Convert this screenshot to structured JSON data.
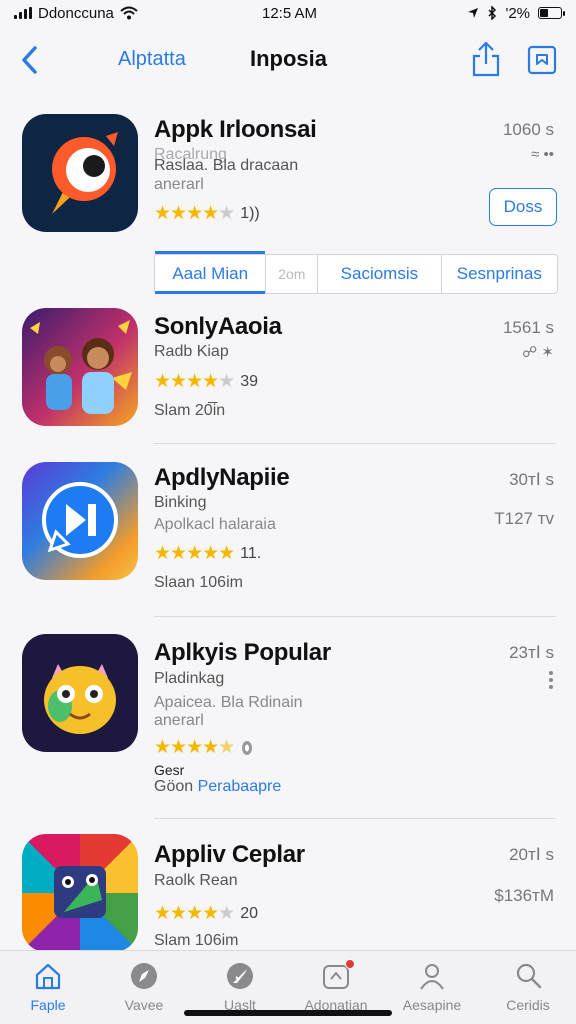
{
  "status_bar": {
    "carrier": "Ddonccuna",
    "time": "12:5 AM",
    "battery_text": "'2%"
  },
  "nav": {
    "back_label": "Alptatta",
    "title": "Inposia"
  },
  "featured": {
    "name": "Appk Irloonsai",
    "subtitle1": "Racalrung",
    "subtitle2": "Raslaa. Bla dracaan",
    "subtitle3": "anerarl",
    "rating_count": "1))",
    "size": "1060 s",
    "size_glyph": "≈ ••",
    "get_label": "Doss"
  },
  "segments": [
    {
      "label": "Aaal Mian"
    },
    {
      "label": "2om"
    },
    {
      "label": "Saciomsis"
    },
    {
      "label": "Sesnprinas"
    }
  ],
  "apps": [
    {
      "name": "SonlyAaoia",
      "subtitle1": "Radb Kiap",
      "rating_count": "39",
      "footer": "Slam 20̅̅in",
      "size": "1561 s",
      "size_glyph": "☍ ✶"
    },
    {
      "name": "ApdlyNapiie",
      "subtitle1": "Binking",
      "subtitle2": "Apolkacl halaraia",
      "rating_count": "11.",
      "footer": "Slaan 106im",
      "size": "30ᴛⅠ s",
      "size2": "Τ127 ᴛᴠ"
    },
    {
      "name": "Aplkyis Popular",
      "subtitle1": "Pladinkag",
      "subtitle2": "Apaicea. Bla Rdinain",
      "subtitle3": "anerarl",
      "footer1": "Gesr",
      "footer2_prefix": "Göon",
      "footer2_link": "Perabaapre",
      "size": "23ᴛⅠ s"
    },
    {
      "name": "Appliv Ceplar",
      "subtitle1": "Raolk Rean",
      "rating_count": "20",
      "footer": "Slam 106im",
      "size": "20ᴛⅠ s",
      "size2": "$136ᴛM"
    }
  ],
  "tabs": [
    {
      "label": "Faple",
      "icon": "home-icon"
    },
    {
      "label": "Vavee",
      "icon": "compass-icon"
    },
    {
      "label": "Uaslt",
      "icon": "rocket-icon"
    },
    {
      "label": "Adonatian",
      "icon": "notification-icon"
    },
    {
      "label": "Aesapine",
      "icon": "person-icon"
    },
    {
      "label": "Ceridis",
      "icon": "search-icon"
    }
  ],
  "colors": {
    "accent": "#2a7be4",
    "star": "#f5b800"
  }
}
